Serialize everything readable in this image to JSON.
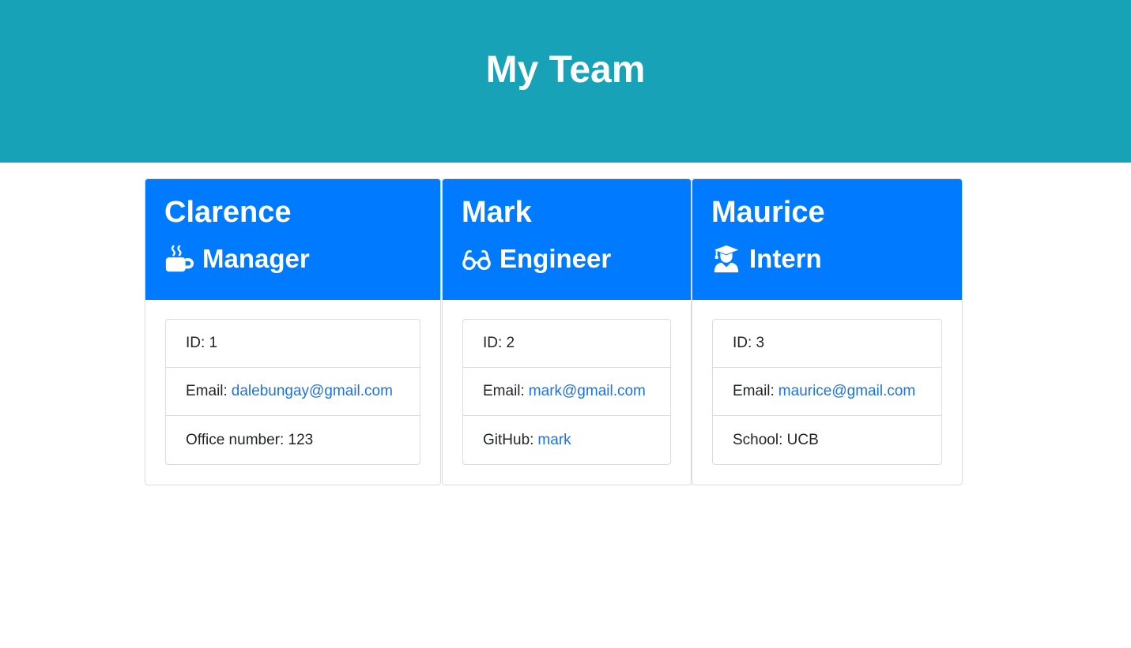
{
  "header": {
    "title": "My Team"
  },
  "team": [
    {
      "name": "Clarence",
      "role": "Manager",
      "role_icon": "coffee-icon",
      "id_label": "ID: 1",
      "email_label": "Email:",
      "email": "dalebungay@gmail.com",
      "extra_label": "Office number: 123",
      "extra_link": ""
    },
    {
      "name": "Mark",
      "role": "Engineer",
      "role_icon": "glasses-icon",
      "id_label": "ID: 2",
      "email_label": "Email:",
      "email": "mark@gmail.com",
      "extra_label": "GitHub:",
      "extra_link": "mark"
    },
    {
      "name": "Maurice",
      "role": "Intern",
      "role_icon": "graduate-icon",
      "id_label": "ID: 3",
      "email_label": "Email:",
      "email": "maurice@gmail.com",
      "extra_label": "School: UCB",
      "extra_link": ""
    }
  ],
  "colors": {
    "header_bg": "#17a2b8",
    "card_header_bg": "#007bff",
    "link": "#1a73e8"
  }
}
